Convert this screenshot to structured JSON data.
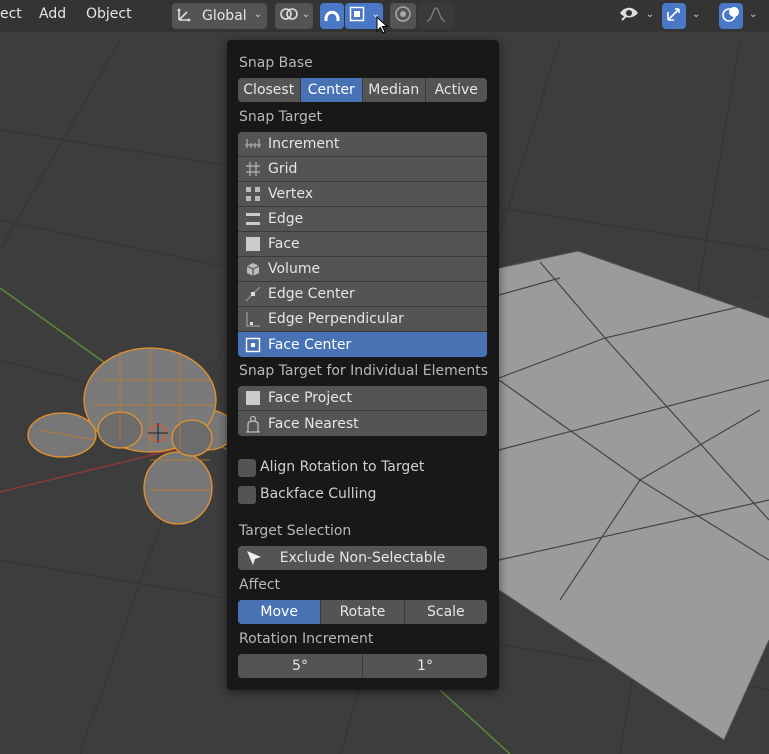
{
  "colors": {
    "viewport_bg": "#3d3d3d",
    "panel_bg": "#181818",
    "widget": "#545454",
    "accent": "#4772b3",
    "selection_outline": "#e8932a"
  },
  "menu": {
    "items": [
      "ect",
      "Add",
      "Object"
    ]
  },
  "header": {
    "orientation_label": "Global",
    "orientation_icon": "transform-orientation-icon",
    "pivot_icon": "link-pivot-icon",
    "snap_icon": "magnet-snap-icon",
    "snap_element_icon": "snap-face-center-icon",
    "proportional_icon": "proportional-edit-icon",
    "falloff_icon": "falloff-curve-icon",
    "visibility_icon": "eye-icon",
    "gizmo_icon": "gizmo-icon",
    "overlay_icon": "overlay-icon"
  },
  "snap_popup": {
    "snap_base": {
      "label": "Snap Base",
      "options": [
        "Closest",
        "Center",
        "Median",
        "Active"
      ],
      "selected": "Center"
    },
    "snap_target": {
      "label": "Snap Target",
      "items": [
        {
          "label": "Increment",
          "icon": "increment-icon",
          "selected": false
        },
        {
          "label": "Grid",
          "icon": "grid-icon",
          "selected": false
        },
        {
          "label": "Vertex",
          "icon": "vertex-icon",
          "selected": false
        },
        {
          "label": "Edge",
          "icon": "edge-icon",
          "selected": false
        },
        {
          "label": "Face",
          "icon": "face-icon",
          "selected": false
        },
        {
          "label": "Volume",
          "icon": "volume-icon",
          "selected": false
        },
        {
          "label": "Edge Center",
          "icon": "edge-center-icon",
          "selected": false
        },
        {
          "label": "Edge Perpendicular",
          "icon": "edge-perpendicular-icon",
          "selected": false
        },
        {
          "label": "Face Center",
          "icon": "face-center-icon",
          "selected": true
        }
      ]
    },
    "individual": {
      "label": "Snap Target for Individual Elements",
      "items": [
        {
          "label": "Face Project",
          "icon": "face-project-icon",
          "selected": false
        },
        {
          "label": "Face Nearest",
          "icon": "face-nearest-icon",
          "selected": false
        }
      ]
    },
    "align_rotation": {
      "label": "Align Rotation to Target",
      "checked": false
    },
    "backface_culling": {
      "label": "Backface Culling",
      "checked": false
    },
    "target_selection": {
      "label": "Target Selection",
      "button": "Exclude Non-Selectable",
      "icon": "cursor-arrow-icon"
    },
    "affect": {
      "label": "Affect",
      "options": [
        "Move",
        "Rotate",
        "Scale"
      ],
      "selected": "Move"
    },
    "rotation_increment": {
      "label": "Rotation Increment",
      "options": [
        "5°",
        "1°"
      ]
    }
  }
}
